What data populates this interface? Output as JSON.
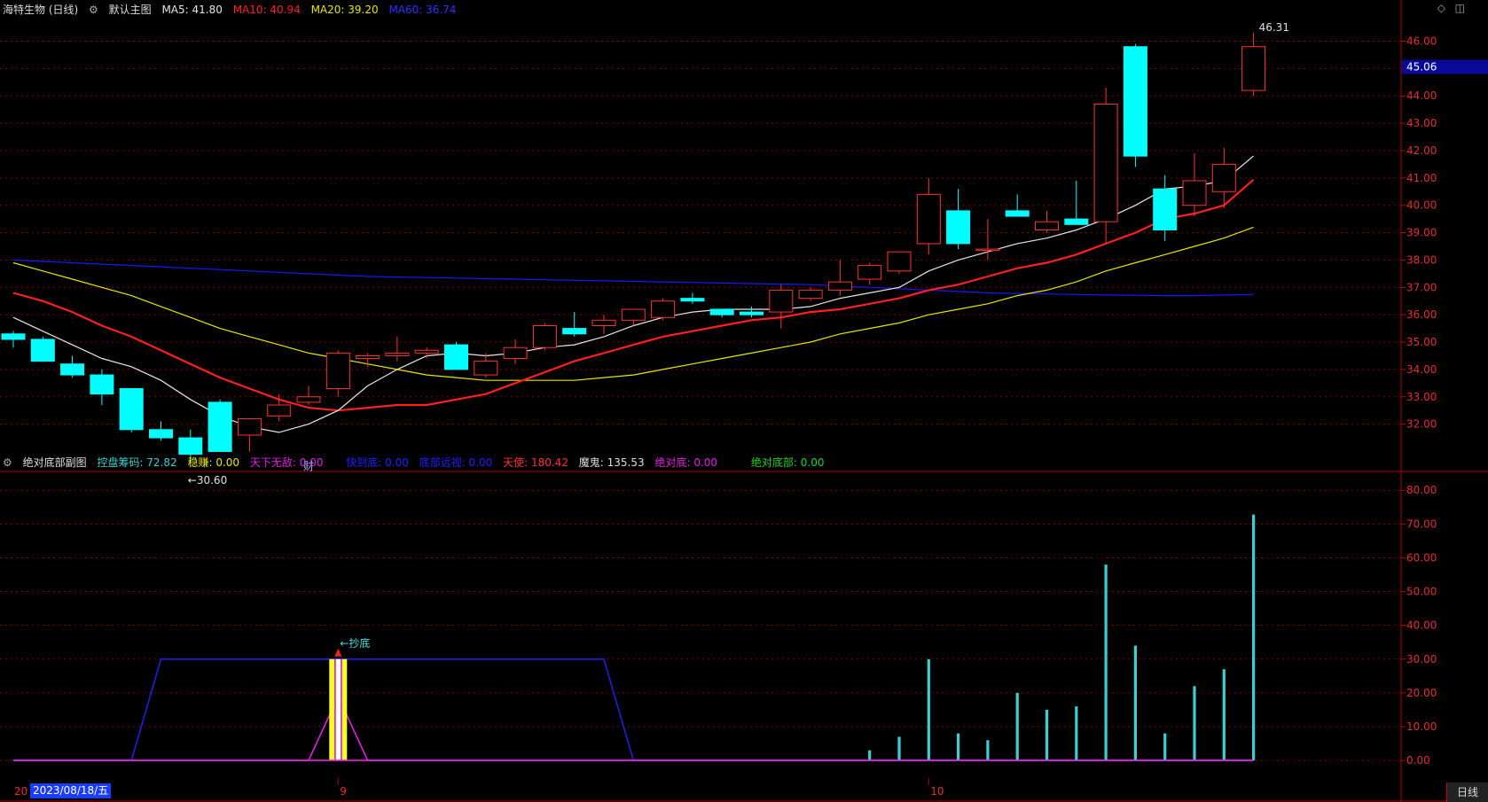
{
  "main_header": {
    "stock": "海特生物 (日线)",
    "template": "默认主图",
    "ma5": "MA5: 41.80",
    "ma10": "MA10: 40.94",
    "ma20": "MA20: 39.20",
    "ma60": "MA60: 36.74"
  },
  "sub_header": {
    "title": "绝对底部副图",
    "i1": "控盘筹码: 72.82",
    "i2": "稳赚: 0.00",
    "i3": "天下无敌: 0.00",
    "i4": "快到底: 0.00",
    "i5": "底部远视: 0.00",
    "i6": "天使: 180.42",
    "i7": "魔鬼: 135.53",
    "i8": "绝对底: 0.00",
    "i9": "绝对底部: 0.00"
  },
  "colors": {
    "up": "#ff3232",
    "down": "#00ffff",
    "ma5": "#e6e6e6",
    "ma10": "#ff2020",
    "ma20": "#e6e600",
    "ma60": "#1818ff",
    "bg": "#000000"
  },
  "axis_bottom": {
    "date_badge": "2023/08/18/五",
    "sep_label": "9",
    "oct_label": "10",
    "period_tab": "日线",
    "left_stub": "20"
  },
  "annotations": {
    "low": "←30.60",
    "high": "46.31",
    "cai": "财",
    "chaodi": "←抄底",
    "price_tag": "45.06"
  },
  "chart_data": [
    {
      "type": "candlestick",
      "title": "海特生物 (日线)",
      "ylim": [
        30.4,
        46.6
      ],
      "yticks": [
        "32.00",
        "33.00",
        "34.00",
        "35.00",
        "36.00",
        "37.00",
        "38.00",
        "39.00",
        "40.00",
        "41.00",
        "42.00",
        "43.00",
        "44.00",
        "45.00",
        "46.00"
      ],
      "current_price": 45.06,
      "candles": [
        {
          "o": 35.3,
          "h": 35.4,
          "l": 34.8,
          "c": 35.1
        },
        {
          "o": 35.1,
          "h": 35.2,
          "l": 34.3,
          "c": 34.3
        },
        {
          "o": 34.2,
          "h": 34.5,
          "l": 33.7,
          "c": 33.8
        },
        {
          "o": 33.8,
          "h": 34.0,
          "l": 32.7,
          "c": 33.1
        },
        {
          "o": 33.3,
          "h": 33.3,
          "l": 31.7,
          "c": 31.8
        },
        {
          "o": 31.8,
          "h": 32.1,
          "l": 31.4,
          "c": 31.5
        },
        {
          "o": 31.5,
          "h": 31.8,
          "l": 30.6,
          "c": 30.9
        },
        {
          "o": 32.8,
          "h": 32.9,
          "l": 31.1,
          "c": 31.0
        },
        {
          "o": 31.6,
          "h": 32.2,
          "l": 31.0,
          "c": 32.2
        },
        {
          "o": 32.3,
          "h": 33.1,
          "l": 32.1,
          "c": 32.7
        },
        {
          "o": 32.8,
          "h": 33.4,
          "l": 32.7,
          "c": 33.0
        },
        {
          "o": 33.3,
          "h": 34.7,
          "l": 33.0,
          "c": 34.6
        },
        {
          "o": 34.4,
          "h": 34.6,
          "l": 34.1,
          "c": 34.5
        },
        {
          "o": 34.5,
          "h": 35.2,
          "l": 34.3,
          "c": 34.6
        },
        {
          "o": 34.6,
          "h": 34.8,
          "l": 34.4,
          "c": 34.7
        },
        {
          "o": 34.9,
          "h": 35.0,
          "l": 34.0,
          "c": 34.0
        },
        {
          "o": 33.8,
          "h": 34.6,
          "l": 33.7,
          "c": 34.3
        },
        {
          "o": 34.4,
          "h": 35.1,
          "l": 34.2,
          "c": 34.8
        },
        {
          "o": 34.8,
          "h": 35.7,
          "l": 34.7,
          "c": 35.6
        },
        {
          "o": 35.5,
          "h": 36.1,
          "l": 35.2,
          "c": 35.3
        },
        {
          "o": 35.6,
          "h": 36.0,
          "l": 35.3,
          "c": 35.8
        },
        {
          "o": 35.8,
          "h": 36.1,
          "l": 35.6,
          "c": 36.2
        },
        {
          "o": 35.9,
          "h": 36.6,
          "l": 35.8,
          "c": 36.5
        },
        {
          "o": 36.6,
          "h": 36.8,
          "l": 36.4,
          "c": 36.5
        },
        {
          "o": 36.2,
          "h": 36.2,
          "l": 35.9,
          "c": 36.0
        },
        {
          "o": 36.1,
          "h": 36.3,
          "l": 35.9,
          "c": 36.0
        },
        {
          "o": 36.1,
          "h": 37.1,
          "l": 35.5,
          "c": 36.9
        },
        {
          "o": 36.6,
          "h": 37.0,
          "l": 36.5,
          "c": 36.9
        },
        {
          "o": 36.9,
          "h": 38.0,
          "l": 36.7,
          "c": 37.2
        },
        {
          "o": 37.3,
          "h": 37.9,
          "l": 37.1,
          "c": 37.8
        },
        {
          "o": 37.6,
          "h": 38.3,
          "l": 37.5,
          "c": 38.3
        },
        {
          "o": 38.6,
          "h": 41.0,
          "l": 38.2,
          "c": 40.4
        },
        {
          "o": 39.8,
          "h": 40.6,
          "l": 38.4,
          "c": 38.6
        },
        {
          "o": 38.4,
          "h": 39.5,
          "l": 38.0,
          "c": 38.4
        },
        {
          "o": 39.8,
          "h": 40.4,
          "l": 39.6,
          "c": 39.6
        },
        {
          "o": 39.1,
          "h": 39.8,
          "l": 39.0,
          "c": 39.4
        },
        {
          "o": 39.5,
          "h": 40.9,
          "l": 39.3,
          "c": 39.3
        },
        {
          "o": 39.4,
          "h": 44.3,
          "l": 38.6,
          "c": 43.7
        },
        {
          "o": 45.8,
          "h": 45.9,
          "l": 41.4,
          "c": 41.8
        },
        {
          "o": 40.6,
          "h": 41.1,
          "l": 38.7,
          "c": 39.1
        },
        {
          "o": 40.0,
          "h": 41.9,
          "l": 39.6,
          "c": 40.9
        },
        {
          "o": 40.5,
          "h": 42.1,
          "l": 39.9,
          "c": 41.5
        },
        {
          "o": 44.2,
          "h": 46.31,
          "l": 44.0,
          "c": 45.8
        }
      ],
      "ma5": [
        35.9,
        35.4,
        34.9,
        34.4,
        34.1,
        33.6,
        32.9,
        32.3,
        31.9,
        31.7,
        32.0,
        32.5,
        33.4,
        34.0,
        34.5,
        34.6,
        34.5,
        34.6,
        34.8,
        34.9,
        35.2,
        35.6,
        35.9,
        36.1,
        36.2,
        36.2,
        36.2,
        36.3,
        36.6,
        36.8,
        37.0,
        37.6,
        38.0,
        38.3,
        38.6,
        38.8,
        39.1,
        39.5,
        40.0,
        40.6,
        40.7,
        40.9,
        41.8
      ],
      "ma10": [
        36.8,
        36.5,
        36.1,
        35.6,
        35.2,
        34.7,
        34.2,
        33.7,
        33.3,
        32.9,
        32.6,
        32.5,
        32.6,
        32.7,
        32.7,
        32.9,
        33.1,
        33.5,
        33.9,
        34.3,
        34.6,
        34.9,
        35.2,
        35.4,
        35.6,
        35.8,
        35.9,
        36.1,
        36.2,
        36.4,
        36.6,
        36.9,
        37.1,
        37.4,
        37.7,
        37.9,
        38.2,
        38.6,
        39.0,
        39.5,
        39.7,
        40.0,
        40.94
      ],
      "ma20": [
        37.9,
        37.6,
        37.3,
        37.0,
        36.7,
        36.3,
        35.9,
        35.5,
        35.2,
        34.9,
        34.6,
        34.4,
        34.2,
        34.0,
        33.8,
        33.7,
        33.6,
        33.6,
        33.6,
        33.6,
        33.7,
        33.8,
        34.0,
        34.2,
        34.4,
        34.6,
        34.8,
        35.0,
        35.3,
        35.5,
        35.7,
        36.0,
        36.2,
        36.4,
        36.7,
        36.9,
        37.2,
        37.6,
        37.9,
        38.2,
        38.5,
        38.8,
        39.2
      ],
      "ma60": [
        38.0,
        37.95,
        37.9,
        37.85,
        37.8,
        37.75,
        37.7,
        37.65,
        37.6,
        37.55,
        37.5,
        37.45,
        37.4,
        37.38,
        37.36,
        37.34,
        37.32,
        37.3,
        37.28,
        37.26,
        37.24,
        37.22,
        37.2,
        37.18,
        37.16,
        37.14,
        37.12,
        37.1,
        37.05,
        37.0,
        36.95,
        36.9,
        36.85,
        36.8,
        36.78,
        36.76,
        36.74,
        36.72,
        36.71,
        36.7,
        36.7,
        36.72,
        36.74
      ]
    },
    {
      "type": "bar",
      "title": "绝对底部副图",
      "ylim": [
        -11,
        84
      ],
      "yticks": [
        "0.00",
        "10.00",
        "20.00",
        "30.00",
        "40.00",
        "50.00",
        "60.00",
        "70.00",
        "80.00"
      ],
      "series": [
        {
          "name": "控盘筹码",
          "values": [
            0,
            0,
            0,
            0,
            0,
            0,
            0,
            0,
            0,
            0,
            0,
            0,
            0,
            0,
            0,
            0,
            0,
            0,
            0,
            0,
            0,
            0,
            0,
            0,
            0,
            0,
            0,
            0,
            0,
            3,
            7,
            30,
            8,
            6,
            20,
            15,
            16,
            58,
            34,
            8,
            22,
            27,
            72.82
          ]
        },
        {
          "name": "天下无敌",
          "values": [
            0,
            0,
            0,
            0,
            0,
            30,
            30,
            30,
            30,
            30,
            30,
            30,
            30,
            30,
            30,
            30,
            30,
            30,
            30,
            30,
            30,
            0,
            0,
            0,
            0,
            0,
            0,
            0,
            0,
            0,
            0,
            0,
            0,
            0,
            0,
            0,
            0,
            0,
            0,
            0,
            0,
            0,
            0
          ]
        },
        {
          "name": "绝对底",
          "values": [
            0,
            0,
            0,
            0,
            0,
            0,
            0,
            0,
            0,
            0,
            0,
            19,
            0,
            0,
            0,
            0,
            0,
            0,
            0,
            0,
            0,
            0,
            0,
            0,
            0,
            0,
            0,
            0,
            0,
            0,
            0,
            0,
            0,
            0,
            0,
            0,
            0,
            0,
            0,
            0,
            0,
            0,
            0
          ]
        },
        {
          "name": "绝对底部",
          "values": [
            0,
            0,
            0,
            0,
            0,
            0,
            0,
            0,
            0,
            0,
            0,
            30,
            0,
            0,
            0,
            0,
            0,
            0,
            0,
            0,
            0,
            0,
            0,
            0,
            0,
            0,
            0,
            0,
            0,
            0,
            0,
            0,
            0,
            0,
            0,
            0,
            0,
            0,
            0,
            0,
            0,
            0,
            0
          ]
        }
      ]
    }
  ]
}
